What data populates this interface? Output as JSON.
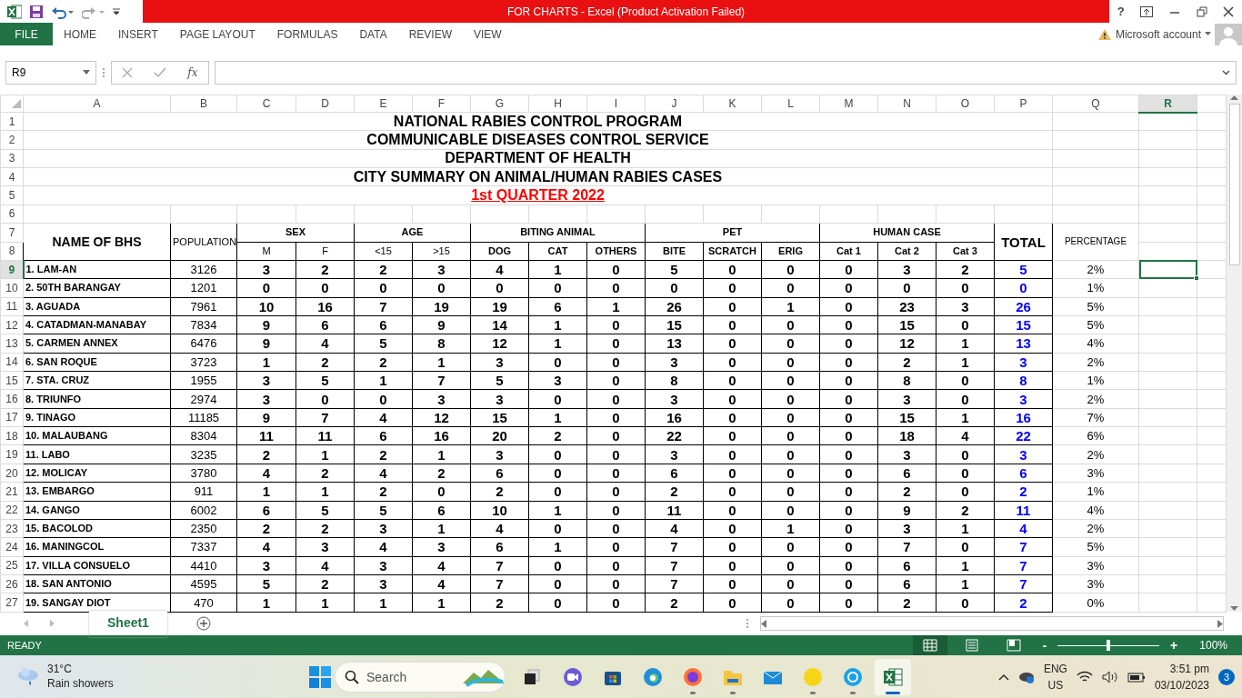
{
  "title_bar": {
    "title": "FOR CHARTS -  Excel (Product Activation Failed)",
    "help": "?"
  },
  "ribbon": {
    "tabs": [
      {
        "label": "FILE",
        "kind": "file"
      },
      {
        "label": "HOME",
        "kind": "tab"
      },
      {
        "label": "INSERT",
        "kind": "tab"
      },
      {
        "label": "PAGE LAYOUT",
        "kind": "tab"
      },
      {
        "label": "FORMULAS",
        "kind": "tab"
      },
      {
        "label": "DATA",
        "kind": "tab"
      },
      {
        "label": "REVIEW",
        "kind": "tab"
      },
      {
        "label": "VIEW",
        "kind": "tab"
      }
    ],
    "account": "Microsoft account"
  },
  "formula_bar": {
    "name_box": "R9",
    "function_label": "fx"
  },
  "sheet": {
    "columns": [
      {
        "label": "A",
        "selected": false
      },
      {
        "label": "B",
        "selected": false
      },
      {
        "label": "C",
        "selected": false
      },
      {
        "label": "D",
        "selected": false
      },
      {
        "label": "E",
        "selected": false
      },
      {
        "label": "F",
        "selected": false
      },
      {
        "label": "G",
        "selected": false
      },
      {
        "label": "H",
        "selected": false
      },
      {
        "label": "I",
        "selected": false
      },
      {
        "label": "J",
        "selected": false
      },
      {
        "label": "K",
        "selected": false
      },
      {
        "label": "L",
        "selected": false
      },
      {
        "label": "M",
        "selected": false
      },
      {
        "label": "N",
        "selected": false
      },
      {
        "label": "O",
        "selected": false
      },
      {
        "label": "P",
        "selected": false
      },
      {
        "label": "Q",
        "selected": false
      },
      {
        "label": "R",
        "selected": true
      }
    ],
    "rows": [
      {
        "label": "1",
        "selected": false
      },
      {
        "label": "2",
        "selected": false
      },
      {
        "label": "3",
        "selected": false
      },
      {
        "label": "4",
        "selected": false
      },
      {
        "label": "5",
        "selected": false
      },
      {
        "label": "6",
        "selected": false
      },
      {
        "label": "7",
        "selected": false
      },
      {
        "label": "8",
        "selected": false
      },
      {
        "label": "9",
        "selected": true
      },
      {
        "label": "10",
        "selected": false
      },
      {
        "label": "11",
        "selected": false
      },
      {
        "label": "12",
        "selected": false
      },
      {
        "label": "13",
        "selected": false
      },
      {
        "label": "14",
        "selected": false
      },
      {
        "label": "15",
        "selected": false
      },
      {
        "label": "16",
        "selected": false
      },
      {
        "label": "17",
        "selected": false
      },
      {
        "label": "18",
        "selected": false
      },
      {
        "label": "19",
        "selected": false
      },
      {
        "label": "20",
        "selected": false
      },
      {
        "label": "21",
        "selected": false
      },
      {
        "label": "22",
        "selected": false
      },
      {
        "label": "23",
        "selected": false
      },
      {
        "label": "24",
        "selected": false
      },
      {
        "label": "25",
        "selected": false
      },
      {
        "label": "26",
        "selected": false
      },
      {
        "label": "27",
        "selected": false
      }
    ],
    "titles": [
      {
        "text": "NATIONAL RABIES CONTROL PROGRAM",
        "kind": "heading"
      },
      {
        "text": "COMMUNICABLE DISEASES CONTROL SERVICE",
        "kind": "heading"
      },
      {
        "text": "DEPARTMENT OF HEALTH",
        "kind": "heading"
      },
      {
        "text": "CITY SUMMARY ON ANIMAL/HUMAN RABIES CASES",
        "kind": "heading"
      },
      {
        "text": "1st QUARTER 2022",
        "kind": "quarter"
      }
    ],
    "header": {
      "name": "NAME OF BHS",
      "population": "POPULATION",
      "groups": [
        {
          "label": "SEX",
          "columns": [
            "M",
            "F"
          ]
        },
        {
          "label": "AGE",
          "columns": [
            "<15",
            ">15"
          ]
        },
        {
          "label": "BITING ANIMAL",
          "columns": [
            "DOG",
            "CAT",
            "OTHERS"
          ]
        },
        {
          "label": "PET",
          "columns": [
            "BITE",
            "SCRATCH",
            "ERIG"
          ]
        },
        {
          "label": "HUMAN CASE",
          "columns": [
            "Cat 1",
            "Cat 2",
            "Cat 3"
          ]
        }
      ],
      "total": "TOTAL",
      "percentage": "PERCENTAGE"
    },
    "data": [
      {
        "name": "1. LAM-AN",
        "population": "3126",
        "values": [
          "3",
          "2",
          "2",
          "3",
          "4",
          "1",
          "0",
          "5",
          "0",
          "0",
          "0",
          "3",
          "2"
        ],
        "total": "5",
        "percentage": "2%"
      },
      {
        "name": "2. 50TH BARANGAY",
        "population": "1201",
        "values": [
          "0",
          "0",
          "0",
          "0",
          "0",
          "0",
          "0",
          "0",
          "0",
          "0",
          "0",
          "0",
          "0"
        ],
        "total": "0",
        "percentage": "1%"
      },
      {
        "name": "3. AGUADA",
        "population": "7961",
        "values": [
          "10",
          "16",
          "7",
          "19",
          "19",
          "6",
          "1",
          "26",
          "0",
          "1",
          "0",
          "23",
          "3"
        ],
        "total": "26",
        "percentage": "5%"
      },
      {
        "name": "4. CATADMAN-MANABAY",
        "population": "7834",
        "values": [
          "9",
          "6",
          "6",
          "9",
          "14",
          "1",
          "0",
          "15",
          "0",
          "0",
          "0",
          "15",
          "0"
        ],
        "total": "15",
        "percentage": "5%"
      },
      {
        "name": "5. CARMEN ANNEX",
        "population": "6476",
        "values": [
          "9",
          "4",
          "5",
          "8",
          "12",
          "1",
          "0",
          "13",
          "0",
          "0",
          "0",
          "12",
          "1"
        ],
        "total": "13",
        "percentage": "4%"
      },
      {
        "name": "6. SAN ROQUE",
        "population": "3723",
        "values": [
          "1",
          "2",
          "2",
          "1",
          "3",
          "0",
          "0",
          "3",
          "0",
          "0",
          "0",
          "2",
          "1"
        ],
        "total": "3",
        "percentage": "2%"
      },
      {
        "name": "7. STA. CRUZ",
        "population": "1955",
        "values": [
          "3",
          "5",
          "1",
          "7",
          "5",
          "3",
          "0",
          "8",
          "0",
          "0",
          "0",
          "8",
          "0"
        ],
        "total": "8",
        "percentage": "1%"
      },
      {
        "name": "8. TRIUNFO",
        "population": "2974",
        "values": [
          "3",
          "0",
          "0",
          "3",
          "3",
          "0",
          "0",
          "3",
          "0",
          "0",
          "0",
          "3",
          "0"
        ],
        "total": "3",
        "percentage": "2%"
      },
      {
        "name": "9. TINAGO",
        "population": "11185",
        "values": [
          "9",
          "7",
          "4",
          "12",
          "15",
          "1",
          "0",
          "16",
          "0",
          "0",
          "0",
          "15",
          "1"
        ],
        "total": "16",
        "percentage": "7%"
      },
      {
        "name": "10. MALAUBANG",
        "population": "8304",
        "values": [
          "11",
          "11",
          "6",
          "16",
          "20",
          "2",
          "0",
          "22",
          "0",
          "0",
          "0",
          "18",
          "4"
        ],
        "total": "22",
        "percentage": "6%"
      },
      {
        "name": "11. LABO",
        "population": "3235",
        "values": [
          "2",
          "1",
          "2",
          "1",
          "3",
          "0",
          "0",
          "3",
          "0",
          "0",
          "0",
          "3",
          "0"
        ],
        "total": "3",
        "percentage": "2%"
      },
      {
        "name": "12. MOLICAY",
        "population": "3780",
        "values": [
          "4",
          "2",
          "4",
          "2",
          "6",
          "0",
          "0",
          "6",
          "0",
          "0",
          "0",
          "6",
          "0"
        ],
        "total": "6",
        "percentage": "3%"
      },
      {
        "name": "13. EMBARGO",
        "population": "911",
        "values": [
          "1",
          "1",
          "2",
          "0",
          "2",
          "0",
          "0",
          "2",
          "0",
          "0",
          "0",
          "2",
          "0"
        ],
        "total": "2",
        "percentage": "1%"
      },
      {
        "name": "14. GANGO",
        "population": "6002",
        "values": [
          "6",
          "5",
          "5",
          "6",
          "10",
          "1",
          "0",
          "11",
          "0",
          "0",
          "0",
          "9",
          "2"
        ],
        "total": "11",
        "percentage": "4%"
      },
      {
        "name": "15. BACOLOD",
        "population": "2350",
        "values": [
          "2",
          "2",
          "3",
          "1",
          "4",
          "0",
          "0",
          "4",
          "0",
          "1",
          "0",
          "3",
          "1"
        ],
        "total": "4",
        "percentage": "2%"
      },
      {
        "name": "16. MANINGCOL",
        "population": "7337",
        "values": [
          "4",
          "3",
          "4",
          "3",
          "6",
          "1",
          "0",
          "7",
          "0",
          "0",
          "0",
          "7",
          "0"
        ],
        "total": "7",
        "percentage": "5%"
      },
      {
        "name": "17. VILLA CONSUELO",
        "population": "4410",
        "values": [
          "3",
          "4",
          "3",
          "4",
          "7",
          "0",
          "0",
          "7",
          "0",
          "0",
          "0",
          "6",
          "1"
        ],
        "total": "7",
        "percentage": "3%"
      },
      {
        "name": "18. SAN ANTONIO",
        "population": "4595",
        "values": [
          "5",
          "2",
          "3",
          "4",
          "7",
          "0",
          "0",
          "7",
          "0",
          "0",
          "0",
          "6",
          "1"
        ],
        "total": "7",
        "percentage": "3%"
      },
      {
        "name": "19. SANGAY DIOT",
        "population": "470",
        "values": [
          "1",
          "1",
          "1",
          "1",
          "2",
          "0",
          "0",
          "2",
          "0",
          "0",
          "0",
          "2",
          "0"
        ],
        "total": "2",
        "percentage": "0%"
      }
    ]
  },
  "sheet_tabs": [
    {
      "label": "Sheet1",
      "selected": true
    }
  ],
  "status_bar": {
    "status": "READY",
    "views": [
      {
        "kind": "normal",
        "selected": true
      },
      {
        "kind": "layout",
        "selected": false
      },
      {
        "kind": "pagebreak",
        "selected": false
      }
    ],
    "zoom_out": "-",
    "zoom_in": "+",
    "zoom": {
      "level": 0.5
    },
    "zoom_reading": "100%"
  },
  "taskbar": {
    "weather": {
      "temperature": "31°C",
      "condition": "Rain showers"
    },
    "search": {
      "placeholder": "Search"
    },
    "apps": [
      {
        "kind": "taskview",
        "running": false,
        "selected": false
      },
      {
        "kind": "meet",
        "running": false,
        "selected": false
      },
      {
        "kind": "store",
        "running": false,
        "selected": false
      },
      {
        "kind": "edge",
        "running": false,
        "selected": false
      },
      {
        "kind": "firefox",
        "running": true,
        "selected": false
      },
      {
        "kind": "folder",
        "running": true,
        "selected": false
      },
      {
        "kind": "mail",
        "running": false,
        "selected": false
      },
      {
        "kind": "chat",
        "running": true,
        "selected": false
      },
      {
        "kind": "skype",
        "running": true,
        "selected": false
      },
      {
        "kind": "excel",
        "running": true,
        "selected": true
      }
    ],
    "language": [
      "ENG",
      "US"
    ],
    "time": "3:51 pm",
    "date": "03/10/2023",
    "notification_count": "3"
  }
}
